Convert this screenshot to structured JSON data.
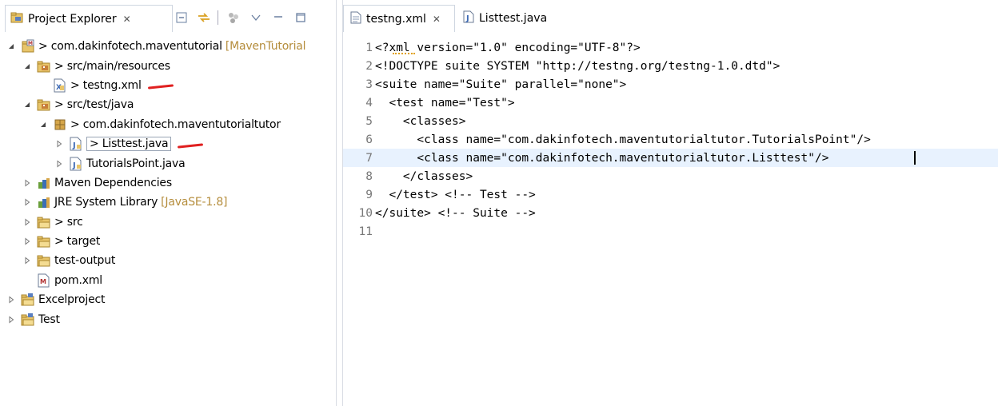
{
  "left_panel": {
    "title": "Project Explorer",
    "close": "✕",
    "tree": [
      {
        "label": "> com.dakinfotech.maventutorial",
        "decoration": "[MavenTutorial",
        "level": 0,
        "expand": "open",
        "icon": "maven-project-icon"
      },
      {
        "label": "> src/main/resources",
        "level": 1,
        "expand": "open",
        "icon": "source-folder-icon"
      },
      {
        "label": "> testng.xml",
        "level": 2,
        "expand": "none",
        "icon": "xml-file-icon",
        "annotated": true
      },
      {
        "label": "> src/test/java",
        "level": 1,
        "expand": "open",
        "icon": "source-folder-icon"
      },
      {
        "label": "> com.dakinfotech.maventutorialtutor",
        "level": 2,
        "expand": "open",
        "icon": "package-icon"
      },
      {
        "label": "> Listtest.java",
        "level": 3,
        "expand": "closed",
        "icon": "java-file-icon",
        "annotated": true,
        "selected": true
      },
      {
        "label": "TutorialsPoint.java",
        "level": 3,
        "expand": "closed",
        "icon": "java-file-icon"
      },
      {
        "label": "Maven Dependencies",
        "level": 1,
        "expand": "closed",
        "icon": "library-icon"
      },
      {
        "label": "JRE System Library",
        "decoration": "[JavaSE-1.8]",
        "level": 1,
        "expand": "closed",
        "icon": "library-icon"
      },
      {
        "label": "> src",
        "level": 1,
        "expand": "closed",
        "icon": "folder-icon"
      },
      {
        "label": "> target",
        "level": 1,
        "expand": "closed",
        "icon": "folder-icon"
      },
      {
        "label": "test-output",
        "level": 1,
        "expand": "closed",
        "icon": "folder-icon"
      },
      {
        "label": "pom.xml",
        "level": 1,
        "expand": "none",
        "icon": "maven-pom-icon"
      },
      {
        "label": "Excelproject",
        "level": 0,
        "expand": "closed",
        "icon": "project-icon"
      },
      {
        "label": "Test",
        "level": 0,
        "expand": "closed",
        "icon": "project-icon"
      }
    ]
  },
  "editor": {
    "tabs": [
      {
        "label": "testng.xml",
        "active": true,
        "icon": "xml-file-icon",
        "close": "✕"
      },
      {
        "label": "Listtest.java",
        "active": false,
        "icon": "java-file-icon"
      }
    ],
    "lines": [
      {
        "num": "1",
        "text": "<?xml version=\"1.0\" encoding=\"UTF-8\"?>"
      },
      {
        "num": "2",
        "text": "<!DOCTYPE suite SYSTEM \"http://testng.org/testng-1.0.dtd\">"
      },
      {
        "num": "3",
        "text": "<suite name=\"Suite\" parallel=\"none\">"
      },
      {
        "num": "4",
        "text": "  <test name=\"Test\">"
      },
      {
        "num": "5",
        "text": "    <classes>"
      },
      {
        "num": "6",
        "text": "      <class name=\"com.dakinfotech.maventutorialtutor.TutorialsPoint\"/>"
      },
      {
        "num": "7",
        "text": "      <class name=\"com.dakinfotech.maventutorialtutor.Listtest\"/>",
        "current": true
      },
      {
        "num": "8",
        "text": "    </classes>"
      },
      {
        "num": "9",
        "text": "  </test> <!-- Test -->"
      },
      {
        "num": "10",
        "text": "</suite> <!-- Suite -->"
      },
      {
        "num": "11",
        "text": ""
      }
    ]
  }
}
